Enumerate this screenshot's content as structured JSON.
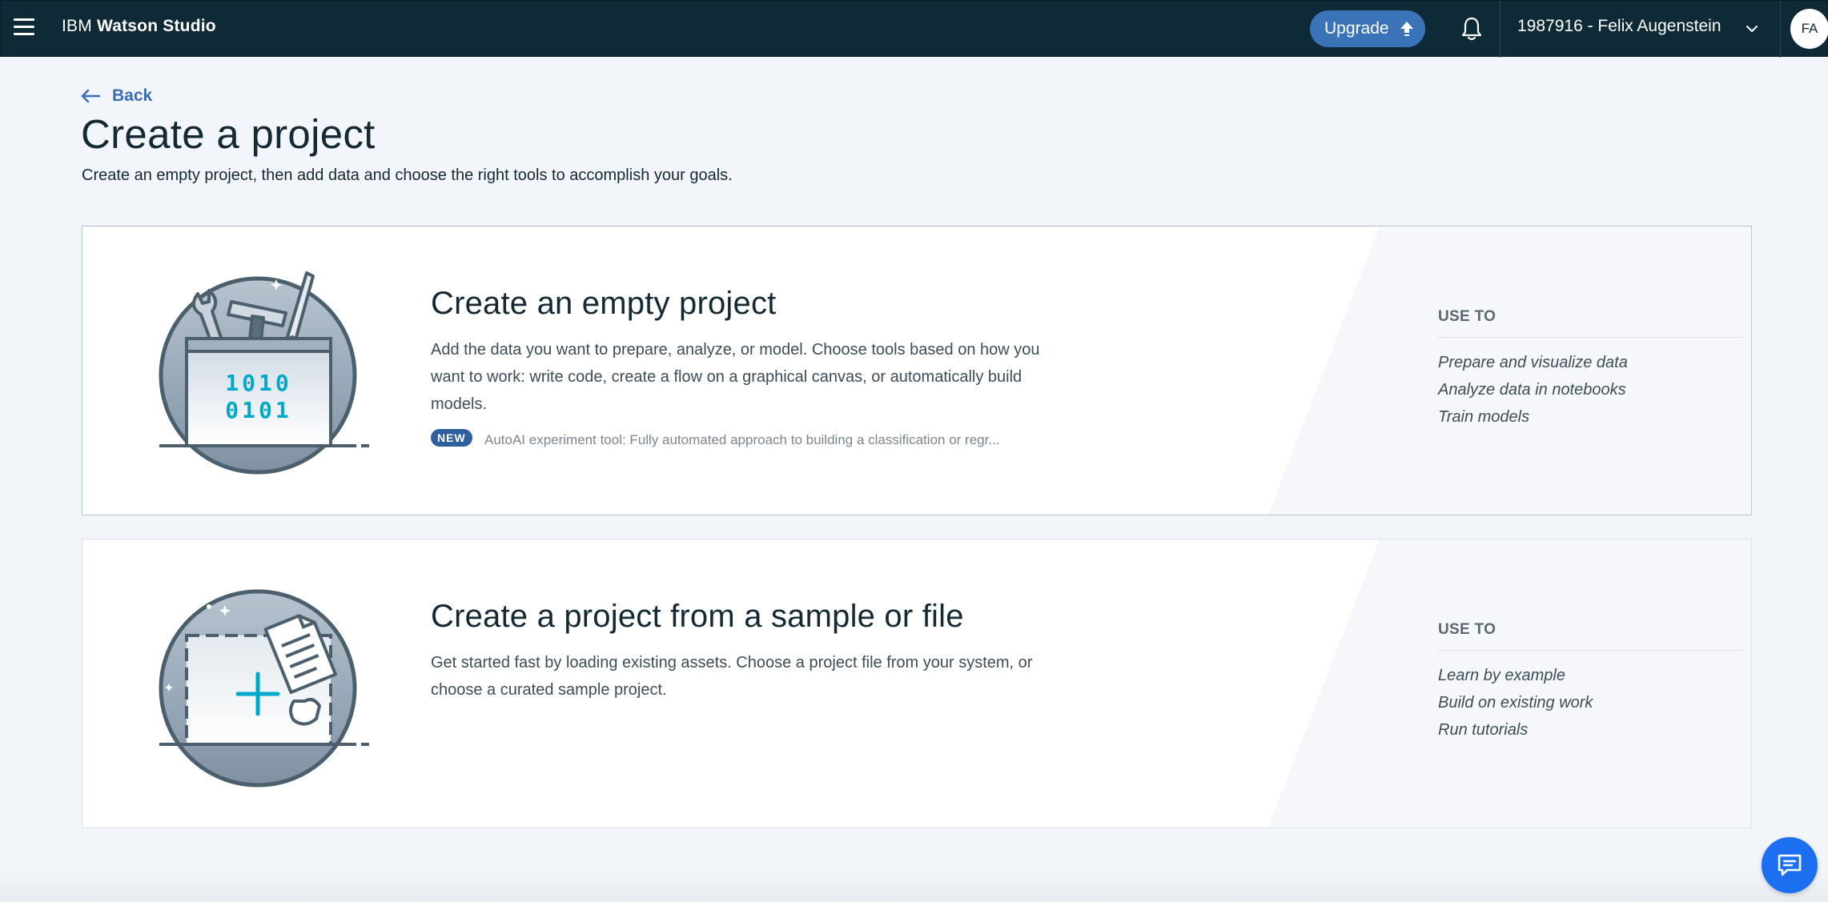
{
  "header": {
    "brand_prefix": "IBM",
    "brand_name": "Watson Studio",
    "upgrade_label": "Upgrade",
    "account_label": "1987916 - Felix Augenstein",
    "avatar_initials": "FA"
  },
  "page": {
    "back_label": "Back",
    "title": "Create a project",
    "subtitle": "Create an empty project, then add data and choose the right tools to accomplish your goals."
  },
  "cards": [
    {
      "title": "Create an empty project",
      "description": "Add the data you want to prepare, analyze, or model. Choose tools based on how you want to work: write code, create a flow on a graphical canvas, or automatically build models.",
      "badge": "NEW",
      "badge_text": "AutoAI experiment tool: Fully automated approach to building a classification or regr...",
      "illustration_text": [
        "1010",
        "0101"
      ],
      "use_to_heading": "USE TO",
      "use_to_items": [
        "Prepare and visualize data",
        "Analyze data in notebooks",
        "Train models"
      ]
    },
    {
      "title": "Create a project from a sample or file",
      "description": "Get started fast by loading existing assets. Choose a project file from your system, or choose a curated sample project.",
      "use_to_heading": "USE TO",
      "use_to_items": [
        "Learn by example",
        "Build on existing work",
        "Run tutorials"
      ]
    }
  ],
  "colors": {
    "topbar": "#0f2a37",
    "accent": "#3b73b9",
    "link": "#3b6db5",
    "binary": "#00a8c9",
    "chat": "#1c6ff0"
  }
}
